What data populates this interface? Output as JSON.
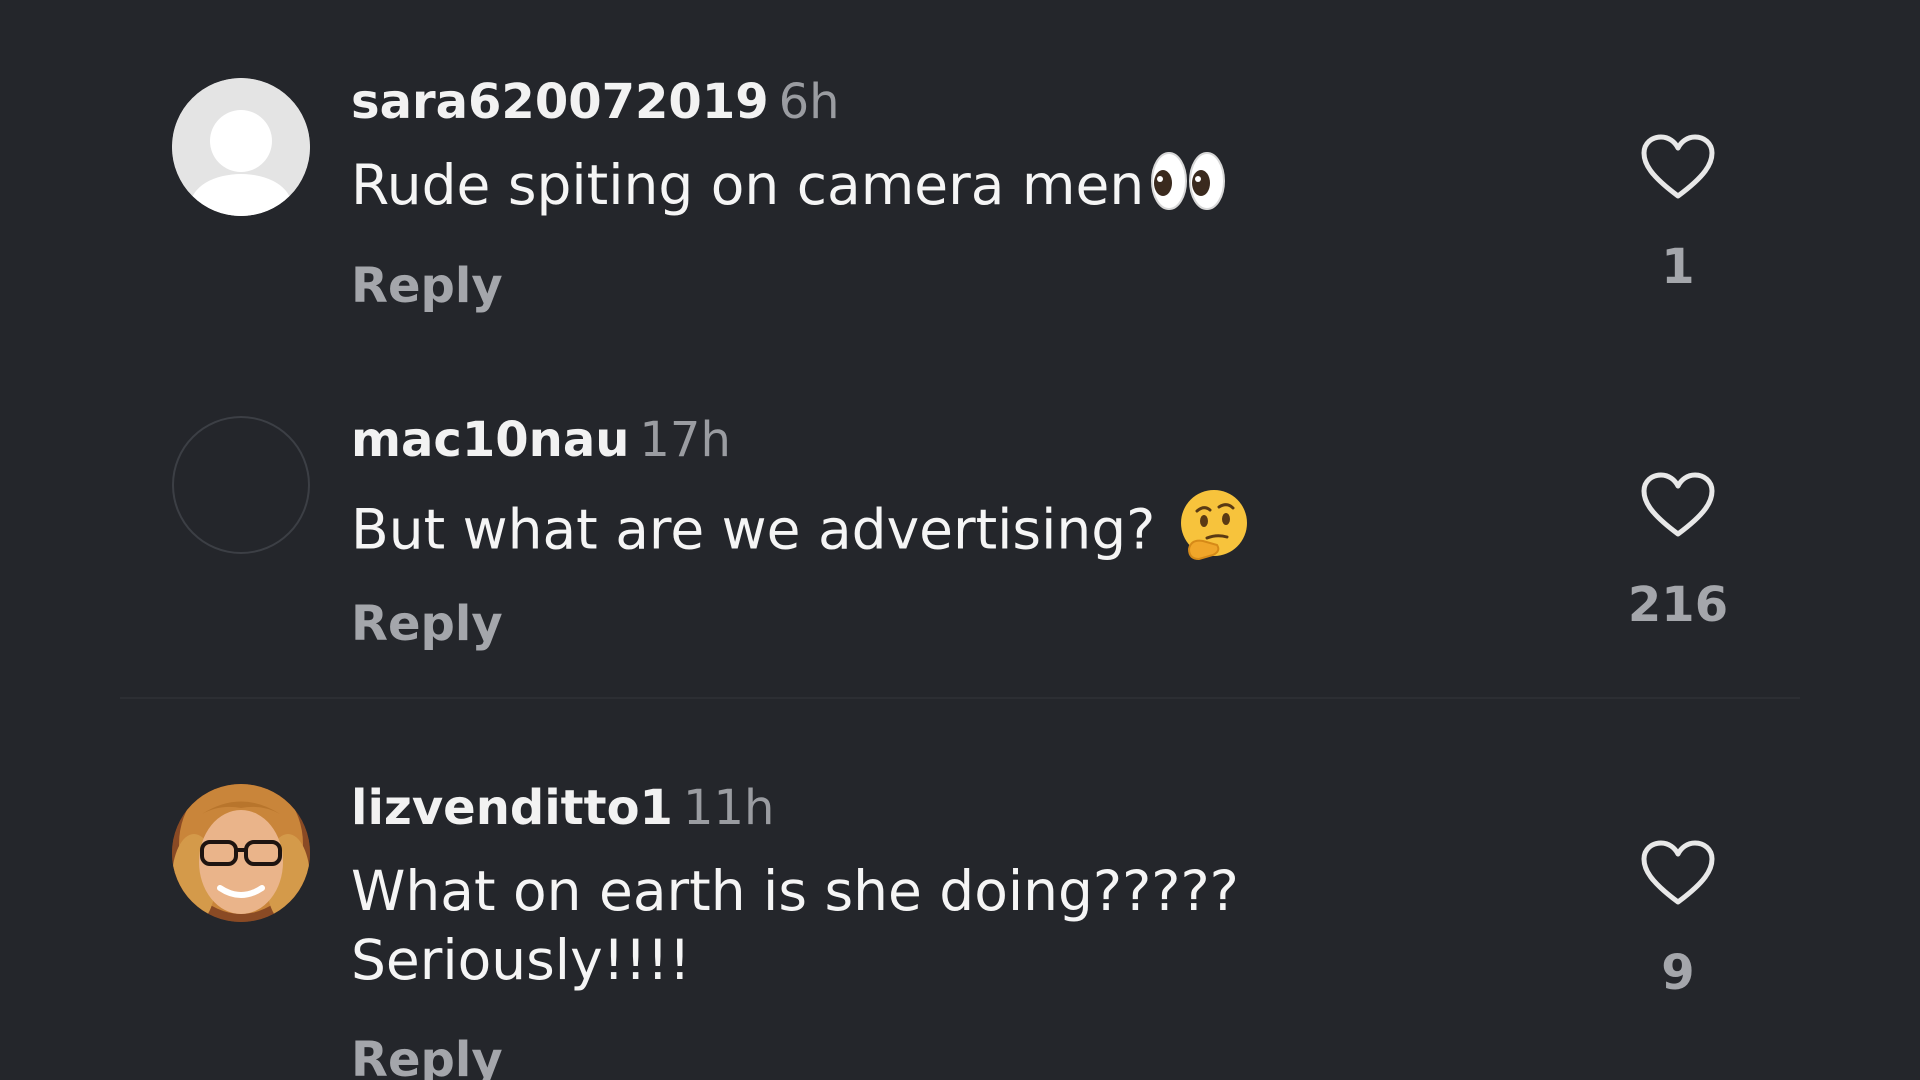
{
  "comments": [
    {
      "username": "sara620072019",
      "time": "6h",
      "text": "Rude spiting on camera men",
      "emoji": "eyes",
      "reply_label": "Reply",
      "likes": "1",
      "avatar": "default-avatar"
    },
    {
      "username": "mac10nau",
      "time": "17h",
      "text": "But what are we advertising?",
      "emoji": "thinking-face",
      "reply_label": "Reply",
      "likes": "216",
      "avatar": "empty-avatar"
    },
    {
      "username": "lizvenditto1",
      "time": "11h",
      "text_line1": "What on earth is she doing?????",
      "text_line2": "Seriously!!!!",
      "reply_label": "Reply",
      "likes": "9",
      "avatar": "photo-avatar"
    }
  ],
  "colors": {
    "background": "#24262b",
    "secondary_text": "#a4a6ab"
  }
}
